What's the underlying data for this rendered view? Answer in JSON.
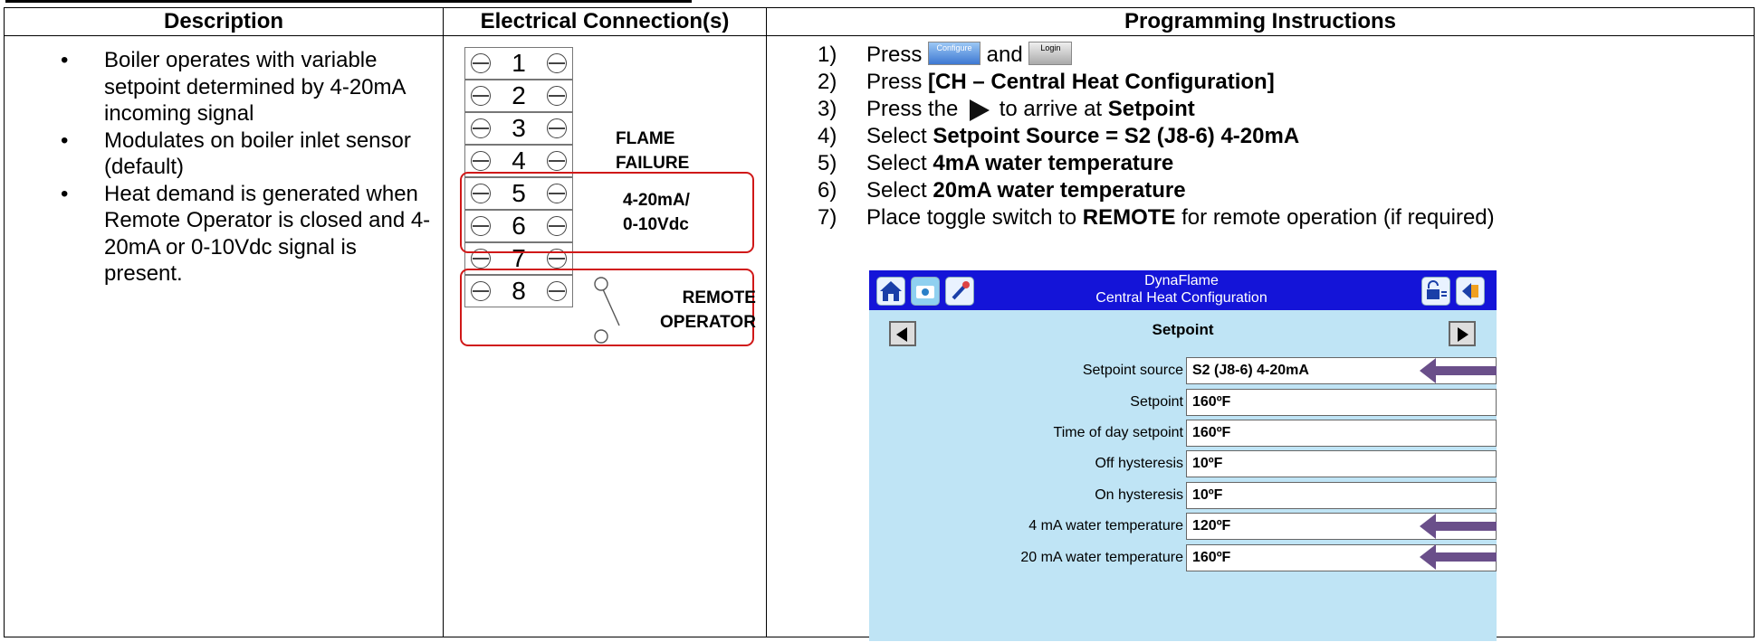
{
  "table": {
    "headers": [
      "Description",
      "Electrical Connection(s)",
      "Programming Instructions"
    ]
  },
  "description": {
    "bullets": [
      "Boiler operates with variable setpoint determined by 4-20mA incoming signal",
      "Modulates on boiler inlet sensor (default)",
      "Heat demand is generated when Remote Operator is closed and 4-20mA or 0-10Vdc signal is present."
    ],
    "bullet_symbol": "•"
  },
  "terminals": {
    "numbers": [
      "1",
      "2",
      "3",
      "4",
      "5",
      "6",
      "7",
      "8"
    ],
    "label_flame_line1": "FLAME",
    "label_flame_line2": "FAILURE",
    "label_signal_line1": "4-20mA/",
    "label_signal_line2": "0-10Vdc",
    "label_remote_line1": "REMOTE",
    "label_remote_line2": "OPERATOR",
    "highlight_color": "#d01818"
  },
  "instructions": {
    "step1": {
      "num": "1)",
      "pre": "Press ",
      "button1": "Configure",
      "mid": " and ",
      "button2": "Login"
    },
    "step2": {
      "num": "2)",
      "pre": "Press ",
      "bold": "[CH – Central Heat Configuration]"
    },
    "step3": {
      "num": "3)",
      "pre": "Press the ",
      "mid": " to arrive at ",
      "bold": "Setpoint"
    },
    "step4": {
      "num": "4)",
      "pre": "Select ",
      "bold": "Setpoint Source = S2 (J8-6) 4-20mA"
    },
    "step5": {
      "num": "5)",
      "pre": "Select ",
      "bold": "4mA water temperature"
    },
    "step6": {
      "num": "6)",
      "pre": "Select ",
      "bold": "20mA water temperature"
    },
    "step7": {
      "num": "7)",
      "pre": "Place toggle switch to ",
      "bold": "REMOTE",
      "post": " for remote operation (if required)"
    }
  },
  "screen": {
    "title_line1": "DynaFlame",
    "title_line2": "Central Heat Configuration",
    "subtitle": "Setpoint",
    "header_color": "#1414d8",
    "background_color": "#bfe4f5",
    "arrow_color": "#6a4f8a",
    "fields": [
      {
        "label": "Setpoint source",
        "value": "S2 (J8-6) 4-20mA"
      },
      {
        "label": "Setpoint",
        "value": "160ºF"
      },
      {
        "label": "Time of day setpoint",
        "value": "160ºF"
      },
      {
        "label": "Off hysteresis",
        "value": "10ºF"
      },
      {
        "label": "On hysteresis",
        "value": "10ºF"
      },
      {
        "label": "4 mA water temperature",
        "value": "120ºF"
      },
      {
        "label": "20 mA water temperature",
        "value": "160ºF"
      }
    ]
  }
}
